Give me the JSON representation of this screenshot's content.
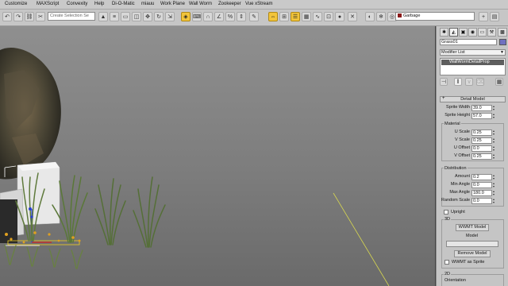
{
  "menu": [
    "Customize",
    "MAXScript",
    "Convexity",
    "Help",
    "Di-O-Matic",
    "miauu",
    "Work Plane",
    "Wall Worm",
    "Zookeeper",
    "Vue xStream"
  ],
  "toolbar": {
    "selection_set_placeholder": "Create Selection Se",
    "layer_value": "Garbage",
    "layer_color": "#8b1a1a",
    "highlight_color": "#f2c43a"
  },
  "cmd_panel": {
    "tabs": [
      "create-icon",
      "modify-icon",
      "hierarchy-icon",
      "motion-icon",
      "display-icon",
      "utilities-icon"
    ],
    "object_name": "Grass01",
    "object_color": "#7070c0",
    "modifier_list": "Modifier List",
    "modifier_stack_item": "WallWormDetailProp",
    "rollout_title": "Detail Model",
    "fields": [
      {
        "label": "Sprite Width",
        "value": "39.0"
      },
      {
        "label": "Sprite Height",
        "value": "57.0"
      }
    ],
    "material": {
      "title": "Material",
      "fields": [
        {
          "label": "U Scale",
          "value": "0.25"
        },
        {
          "label": "V Scale",
          "value": "0.25"
        },
        {
          "label": "U Offset",
          "value": "0.0"
        },
        {
          "label": "V Offset",
          "value": "0.25"
        }
      ]
    },
    "distribution": {
      "title": "Distribution",
      "fields": [
        {
          "label": "Amount",
          "value": "0.2"
        },
        {
          "label": "Min Angle",
          "value": "0.0"
        },
        {
          "label": "Max Angle",
          "value": "180.0"
        },
        {
          "label": "Random Scale",
          "value": "0.0"
        }
      ]
    },
    "upright_label": "Upright",
    "group_3d": "3D",
    "wwmt_model_button": "WWMT Model",
    "model_label": "Model",
    "model_value": "",
    "remove_model_button": "Remove Model",
    "wwmt_sprite_label": "WWMT as Sprite",
    "group_2d": "2D",
    "orientation_label": "Orientation"
  }
}
